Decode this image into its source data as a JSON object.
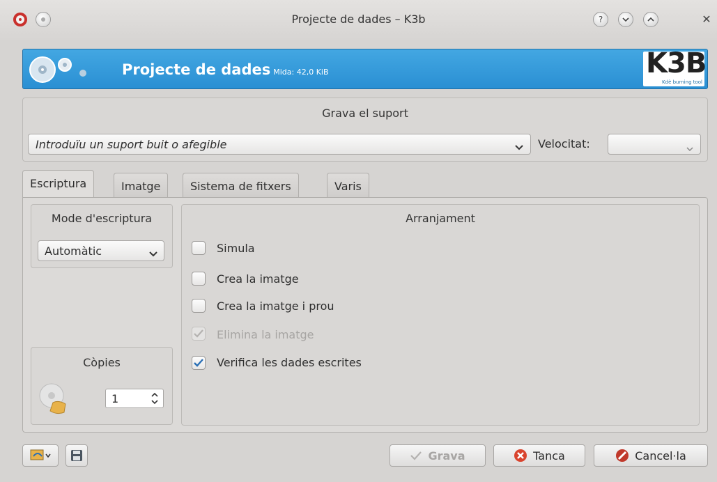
{
  "window": {
    "title": "Projecte de dades – K3b"
  },
  "banner": {
    "title": "Projecte de dades",
    "subtitle": "Mida: 42,0 KiB",
    "logo_text": "K3B",
    "logo_tagline": "Kdè burning tool"
  },
  "burn_medium": {
    "title": "Grava el suport",
    "medium_value": "Introduïu un suport buit o afegible",
    "speed_label": "Velocitat:",
    "speed_value": ""
  },
  "tabs": [
    {
      "label": "Escriptura",
      "active": true
    },
    {
      "label": "Imatge",
      "active": false
    },
    {
      "label": "Sistema de fitxers",
      "active": false
    },
    {
      "label": "Varis",
      "active": false
    }
  ],
  "write_mode": {
    "title": "Mode d'escriptura",
    "value": "Automàtic"
  },
  "copies": {
    "title": "Còpies",
    "value": "1"
  },
  "settings": {
    "title": "Arranjament",
    "options": [
      {
        "label": "Simula",
        "checked": false,
        "enabled": true
      },
      {
        "label": "Crea la imatge",
        "checked": false,
        "enabled": true
      },
      {
        "label": "Crea la imatge i prou",
        "checked": false,
        "enabled": true
      },
      {
        "label": "Elimina la imatge",
        "checked": true,
        "enabled": false
      },
      {
        "label": "Verifica les dades escrites",
        "checked": true,
        "enabled": true
      }
    ]
  },
  "buttons": {
    "burn": "Grava",
    "close": "Tanca",
    "cancel": "Cancel·la"
  },
  "colors": {
    "banner": "#2a8fd3",
    "check": "#2a6fb5",
    "close_icon": "#d9442e",
    "cancel_icon": "#c0392b"
  }
}
